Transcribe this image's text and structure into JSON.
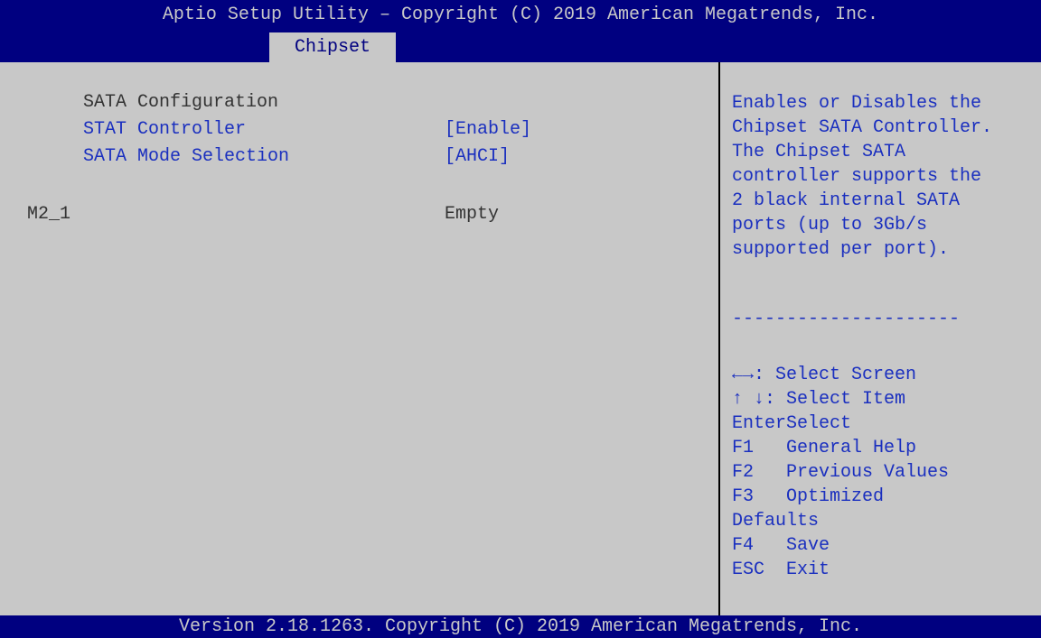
{
  "header": {
    "title": "Aptio Setup Utility – Copyright (C) 2019 American Megatrends, Inc.",
    "tab": "Chipset"
  },
  "main": {
    "section_title": "SATA Configuration",
    "settings": [
      {
        "label": "STAT Controller",
        "value": "[Enable]"
      },
      {
        "label": "SATA Mode Selection",
        "value": "[AHCI]"
      }
    ],
    "ports": [
      {
        "label": "M2_1",
        "value": "Empty"
      }
    ]
  },
  "help": {
    "description": [
      "Enables or Disables the",
      "Chipset SATA Controller.",
      "The Chipset SATA",
      "controller supports the",
      "2 black internal SATA",
      "ports (up to 3Gb/s",
      "supported per port)."
    ],
    "separator": "---------------------",
    "keys": [
      "←→: Select Screen",
      "↑ ↓: Select Item",
      "EnterSelect",
      "F1   General Help",
      "F2   Previous Values",
      "F3   Optimized",
      "Defaults",
      "F4   Save",
      "ESC  Exit"
    ]
  },
  "footer": {
    "version": "Version 2.18.1263. Copyright (C) 2019 American Megatrends, Inc."
  },
  "colors": {
    "header_bg": "#000080",
    "panel_bg": "#c8c8c8",
    "setting_text": "#1a2fbf",
    "static_text": "#333333"
  }
}
